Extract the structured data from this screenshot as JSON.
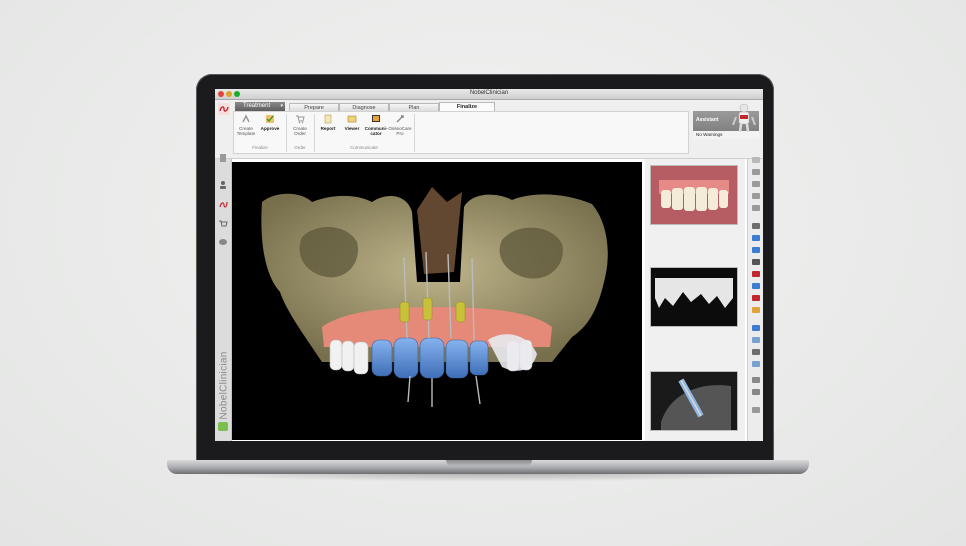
{
  "window": {
    "title": "NobelClinician"
  },
  "ribbon": {
    "mode_label": "Treatment",
    "tabs": [
      {
        "label": "Prepare",
        "active": false
      },
      {
        "label": "Diagnose",
        "active": false
      },
      {
        "label": "Plan",
        "active": false
      },
      {
        "label": "Finalize",
        "active": true
      }
    ],
    "tools": [
      {
        "label": "Create Template",
        "icon": "template-icon"
      },
      {
        "label": "Approve",
        "icon": "approve-icon",
        "strong": true
      },
      {
        "label": "Create Order",
        "icon": "cart-icon"
      },
      {
        "label": "Report",
        "icon": "report-icon",
        "strong": true
      },
      {
        "label": "Viewer",
        "icon": "viewer-icon",
        "strong": true
      },
      {
        "label": "Communi-cator",
        "icon": "communicator-icon",
        "strong": true
      },
      {
        "label": "OsseoCare Pro",
        "icon": "osseocare-icon"
      }
    ],
    "groups": [
      "Finalize",
      "Order",
      "Communicate"
    ]
  },
  "assistant": {
    "title": "Assistant",
    "status": "No Warnings"
  },
  "sidebar": {
    "brand": "NobelClinician"
  },
  "colors": {
    "accent": "#c0282d",
    "power": "#7bbf4e",
    "bone": "#b8ad82",
    "gum": "#e58a78",
    "crown": "#5b8fd6"
  }
}
